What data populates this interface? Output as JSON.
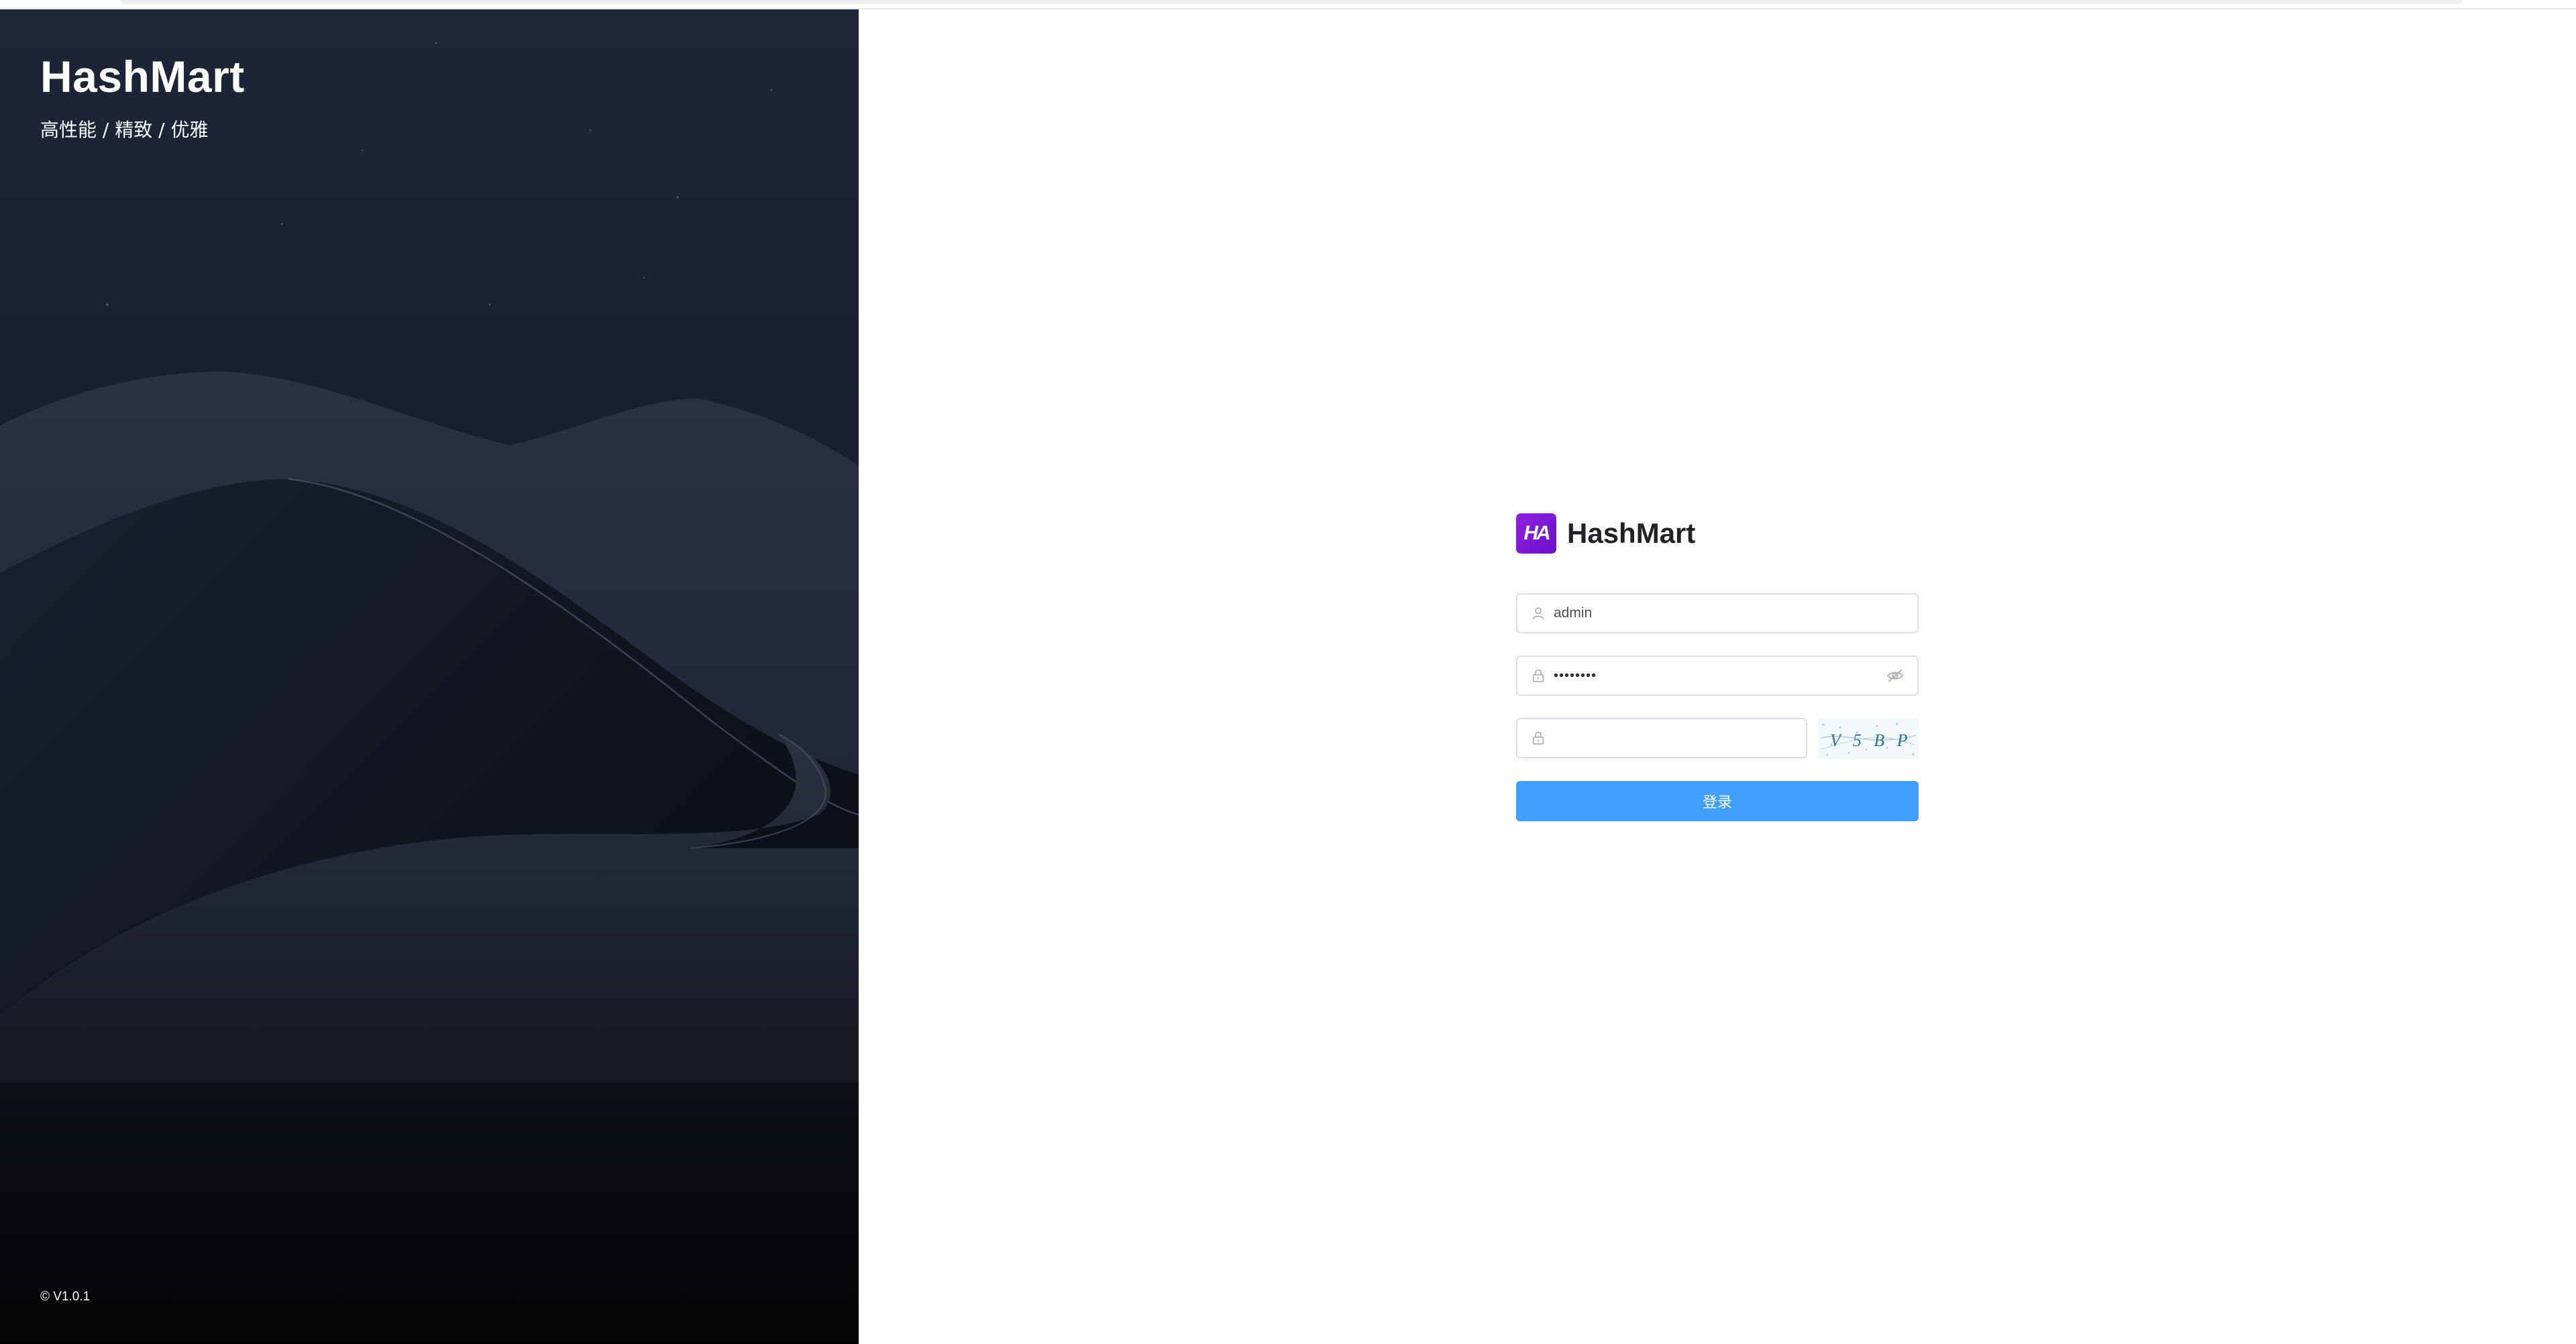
{
  "brand": {
    "name": "HashMart",
    "slogan": "高性能 / 精致 / 优雅",
    "version": "© V1.0.1"
  },
  "login": {
    "logo_mark": "HA",
    "logo_text": "HashMart",
    "username": {
      "value": "admin",
      "icon": "user-icon"
    },
    "password": {
      "value": "••••••••",
      "icon": "lock-icon",
      "toggle_icon": "eye-icon"
    },
    "captcha": {
      "value": "",
      "icon": "lock-icon",
      "image_text": "V 5 B P"
    },
    "submit_label": "登录"
  },
  "colors": {
    "primary": "#409eff",
    "logo": "#7b16d6",
    "left_bg_top": "#1d2637",
    "left_bg_bottom": "#07090e"
  }
}
